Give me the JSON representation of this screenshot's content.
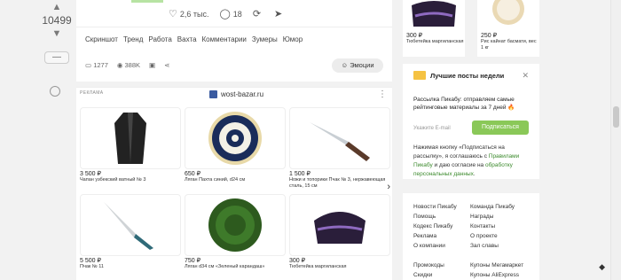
{
  "vote": {
    "count": "10499"
  },
  "post": {
    "likes": "2,6 тыс.",
    "comments": "18",
    "tags": [
      "Скриншот",
      "Тренд",
      "Работа",
      "Вахта",
      "Комментарии",
      "Зумеры",
      "Юмор"
    ],
    "comments_count": "1277",
    "views": "388K",
    "emotions_label": "Эмоции"
  },
  "ad": {
    "label": "РЕКЛАМА",
    "domain": "wost-bazar.ru",
    "items": [
      {
        "price": "3 500 ₽",
        "title": "Чапан узбекский ватный № 3"
      },
      {
        "price": "650 ₽",
        "title": "Ляган Пахта синий, d24 см"
      },
      {
        "price": "1 500 ₽",
        "title": "Ножи и топорики Пчак № 3, нержавеющая сталь, 15 см"
      },
      {
        "price": "5 500 ₽",
        "title": "Пчак № 11"
      },
      {
        "price": "750 ₽",
        "title": "Ляган d34 см «Зеленый карандаш»"
      },
      {
        "price": "300 ₽",
        "title": "Тюбетейка маргиланская"
      }
    ]
  },
  "right_products": [
    {
      "price": "300 ₽",
      "title": "Тюбетейка маргиланская"
    },
    {
      "price": "250 ₽",
      "title": "Рис кайнат басмати, вес 1 кг"
    }
  ],
  "newsletter": {
    "title": "Лучшие посты недели",
    "desc": "Рассылка Пикабу: отправляем самые рейтинговые материалы за 7 дней 🔥",
    "placeholder": "Укажите E-mail",
    "button": "Подписаться",
    "note_a": "Нажимая кнопку «Подписаться на рассылку», я соглашаюсь с ",
    "note_link1": "Правилами Пикабу",
    "note_b": " и даю согласие на ",
    "note_link2": "обработку персональных данных",
    "note_c": "."
  },
  "links": {
    "left": [
      "Новости Пикабу",
      "Помощь",
      "Кодекс Пикабу",
      "Реклама",
      "О компании"
    ],
    "right": [
      "Команда Пикабу",
      "Награды",
      "Контакты",
      "О проекте",
      "Зал славы"
    ],
    "left2": [
      "Промокоды",
      "Скидки"
    ],
    "right2": [
      "Купоны Мегамаркет",
      "Купоны AliExpress"
    ]
  }
}
